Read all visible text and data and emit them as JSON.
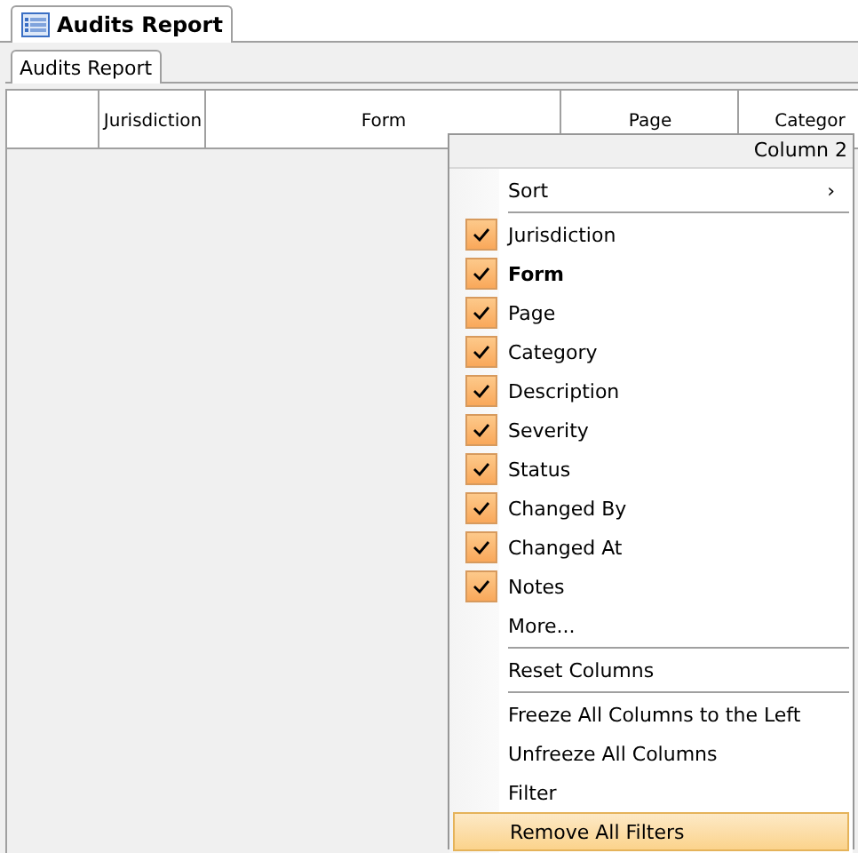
{
  "document_tab": {
    "title": "Audits Report"
  },
  "tabs": [
    {
      "label": "Audits Report",
      "selected": true
    }
  ],
  "table": {
    "columns": [
      "",
      "Jurisdiction",
      "Form",
      "Page",
      "Categor"
    ]
  },
  "context_menu": {
    "title": "Column 2",
    "groups": [
      [
        {
          "kind": "submenu",
          "label": "Sort",
          "arrow": "›",
          "selected": false
        }
      ],
      [
        {
          "kind": "check",
          "label": "Jurisdiction",
          "checked": true,
          "current": false,
          "selected": false
        },
        {
          "kind": "check",
          "label": "Form",
          "checked": true,
          "current": true,
          "selected": false
        },
        {
          "kind": "check",
          "label": "Page",
          "checked": true,
          "current": false,
          "selected": false
        },
        {
          "kind": "check",
          "label": "Category",
          "checked": true,
          "current": false,
          "selected": false
        },
        {
          "kind": "check",
          "label": "Description",
          "checked": true,
          "current": false,
          "selected": false
        },
        {
          "kind": "check",
          "label": "Severity",
          "checked": true,
          "current": false,
          "selected": false
        },
        {
          "kind": "check",
          "label": "Status",
          "checked": true,
          "current": false,
          "selected": false
        },
        {
          "kind": "check",
          "label": "Changed By",
          "checked": true,
          "current": false,
          "selected": false
        },
        {
          "kind": "check",
          "label": "Changed At",
          "checked": true,
          "current": false,
          "selected": false
        },
        {
          "kind": "check",
          "label": "Notes",
          "checked": true,
          "current": false,
          "selected": false
        },
        {
          "kind": "command",
          "label": "More...",
          "selected": false
        }
      ],
      [
        {
          "kind": "command",
          "label": "Reset Columns",
          "selected": false
        }
      ],
      [
        {
          "kind": "command",
          "label": "Freeze All Columns to the Left",
          "selected": false
        },
        {
          "kind": "command",
          "label": "Unfreeze All Columns",
          "selected": false
        },
        {
          "kind": "command",
          "label": "Filter",
          "selected": false
        },
        {
          "kind": "command",
          "label": "Remove All Filters",
          "selected": true
        }
      ]
    ]
  }
}
